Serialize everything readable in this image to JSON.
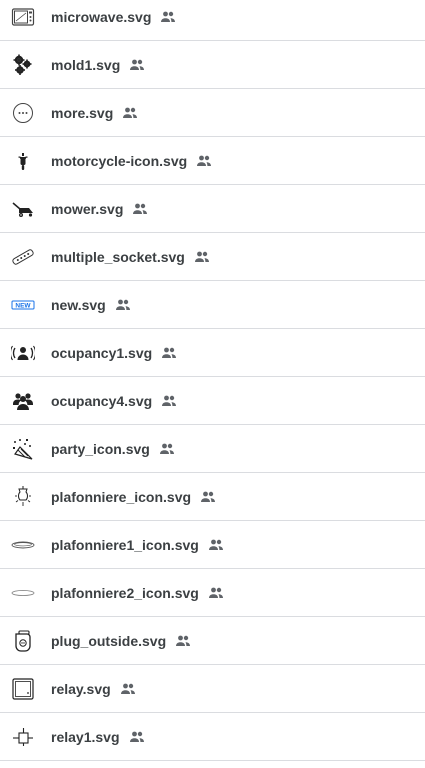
{
  "files": [
    {
      "name": "microwave.svg",
      "icon": "microwave-icon"
    },
    {
      "name": "mold1.svg",
      "icon": "gears-icon"
    },
    {
      "name": "more.svg",
      "icon": "more-icon"
    },
    {
      "name": "motorcycle-icon.svg",
      "icon": "motorcycle-icon"
    },
    {
      "name": "mower.svg",
      "icon": "mower-icon"
    },
    {
      "name": "multiple_socket.svg",
      "icon": "multiple-socket-icon"
    },
    {
      "name": "new.svg",
      "icon": "new-badge-icon",
      "icon_text": "NEW"
    },
    {
      "name": "ocupancy1.svg",
      "icon": "occupancy-person-icon"
    },
    {
      "name": "ocupancy4.svg",
      "icon": "occupancy-group-icon"
    },
    {
      "name": "party_icon.svg",
      "icon": "party-popper-icon"
    },
    {
      "name": "plafonniere_icon.svg",
      "icon": "ceiling-lamp-icon"
    },
    {
      "name": "plafonniere1_icon.svg",
      "icon": "ceiling-plate-icon"
    },
    {
      "name": "plafonniere2_icon.svg",
      "icon": "ceiling-plate-flat-icon"
    },
    {
      "name": "plug_outside.svg",
      "icon": "outdoor-plug-icon"
    },
    {
      "name": "relay.svg",
      "icon": "relay-box-icon"
    },
    {
      "name": "relay1.svg",
      "icon": "relay-switch-icon"
    }
  ],
  "shared_icon": "shared-people-icon",
  "colors": {
    "text": "#3c4043",
    "divider": "#dadce0",
    "icon": "#5f6368",
    "new_badge": "#1a73e8"
  }
}
